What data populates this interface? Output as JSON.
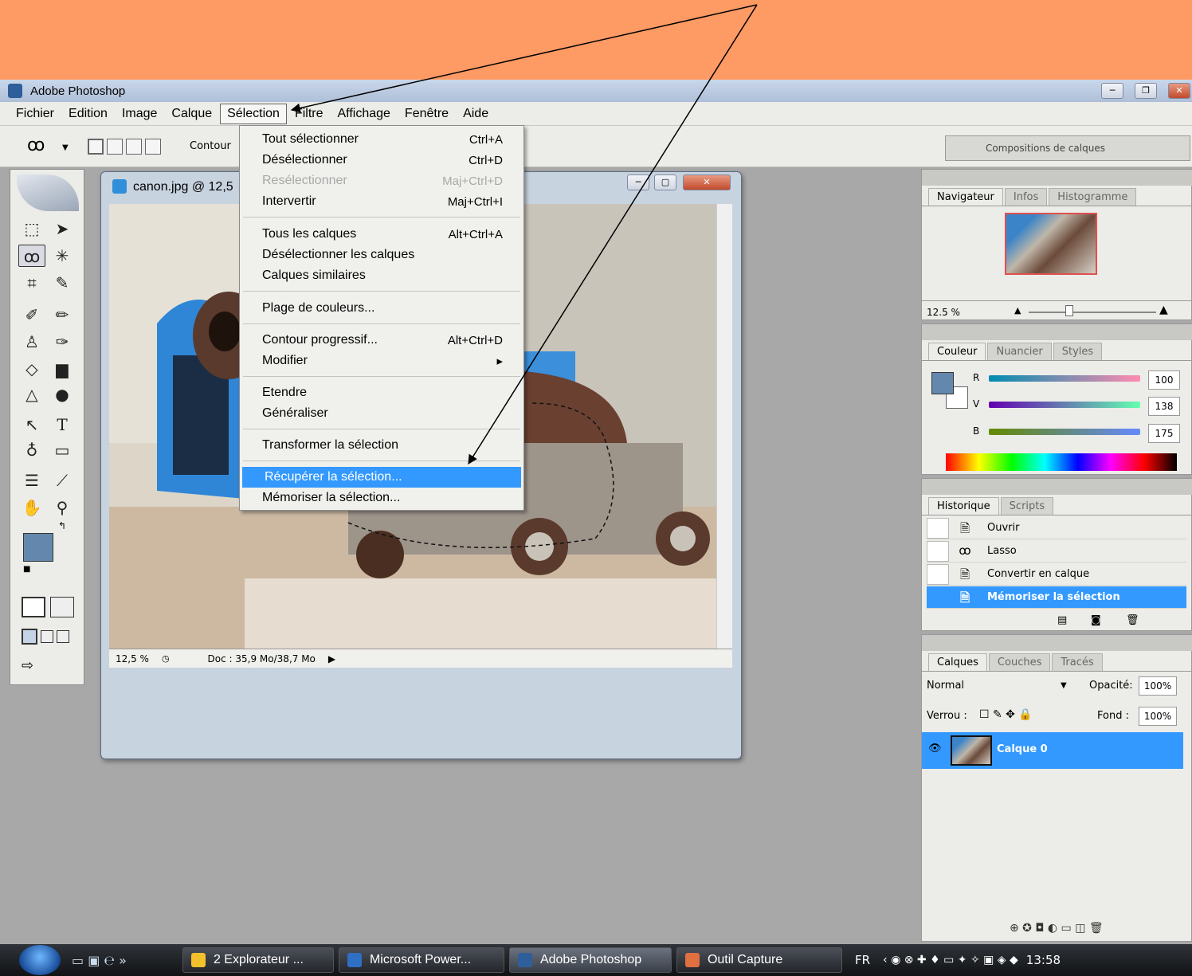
{
  "app": {
    "title": "Adobe Photoshop"
  },
  "menubar": [
    "Fichier",
    "Edition",
    "Image",
    "Calque",
    "Sélection",
    "Filtre",
    "Affichage",
    "Fenêtre",
    "Aide"
  ],
  "options": {
    "contour_label": "Contour",
    "well_label": "Compositions de calques"
  },
  "document": {
    "title": "canon.jpg @ 12,5",
    "zoom": "12,5 %",
    "doc_info": "Doc : 35,9 Mo/38,7 Mo"
  },
  "selection_menu": [
    {
      "label": "Tout sélectionner",
      "shortcut": "Ctrl+A",
      "disabled": false
    },
    {
      "label": "Désélectionner",
      "shortcut": "Ctrl+D",
      "disabled": false
    },
    {
      "label": "Resélectionner",
      "shortcut": "Maj+Ctrl+D",
      "disabled": true
    },
    {
      "label": "Intervertir",
      "shortcut": "Maj+Ctrl+I",
      "disabled": false
    },
    {
      "label": "Tous les calques",
      "shortcut": "Alt+Ctrl+A",
      "disabled": false
    },
    {
      "label": "Désélectionner les calques",
      "shortcut": "",
      "disabled": false
    },
    {
      "label": "Calques similaires",
      "shortcut": "",
      "disabled": false
    },
    {
      "label": "Plage de couleurs...",
      "shortcut": "",
      "disabled": false
    },
    {
      "label": "Contour progressif...",
      "shortcut": "Alt+Ctrl+D",
      "disabled": false
    },
    {
      "label": "Modifier",
      "shortcut": "▸",
      "disabled": false
    },
    {
      "label": "Etendre",
      "shortcut": "",
      "disabled": false
    },
    {
      "label": "Généraliser",
      "shortcut": "",
      "disabled": false
    },
    {
      "label": "Transformer la sélection",
      "shortcut": "",
      "disabled": false
    },
    {
      "label": "Récupérer la sélection...",
      "shortcut": "",
      "disabled": false,
      "highlighted": true
    },
    {
      "label": "Mémoriser la sélection...",
      "shortcut": "",
      "disabled": false
    }
  ],
  "navigator": {
    "tabs": [
      "Navigateur",
      "Infos",
      "Histogramme"
    ],
    "zoom": "12.5 %"
  },
  "color": {
    "tabs": [
      "Couleur",
      "Nuancier",
      "Styles"
    ],
    "channels": [
      {
        "label": "R",
        "value": "100"
      },
      {
        "label": "V",
        "value": "138"
      },
      {
        "label": "B",
        "value": "175"
      }
    ],
    "foreground": "#6488ad"
  },
  "history": {
    "tabs": [
      "Historique",
      "Scripts"
    ],
    "items": [
      "Ouvrir",
      "Lasso",
      "Convertir en calque",
      "Mémoriser la sélection"
    ]
  },
  "layers": {
    "tabs": [
      "Calques",
      "Couches",
      "Tracés"
    ],
    "blend_mode": "Normal",
    "opacity_label": "Opacité:",
    "opacity": "100%",
    "lock_label": "Verrou :",
    "fill_label": "Fond :",
    "fill": "100%",
    "layer_name": "Calque 0"
  },
  "taskbar": {
    "items": [
      "2 Explorateur ...",
      "Microsoft Power...",
      "Adobe Photoshop",
      "Outil Capture"
    ],
    "lang": "FR",
    "clock": "13:58"
  },
  "icons": [
    "lasso-icon",
    "marquee-icon",
    "move-icon",
    "magic-wand-icon",
    "crop-icon",
    "brush-icon",
    "text-icon",
    "hand-icon",
    "zoom-icon",
    "eye-icon"
  ]
}
